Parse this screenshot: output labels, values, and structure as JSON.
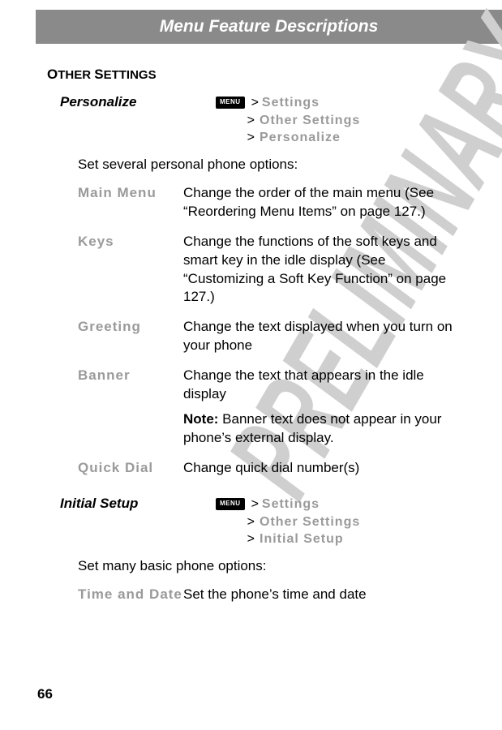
{
  "header": {
    "title": "Menu Feature Descriptions"
  },
  "watermark": "PRELIMINARY",
  "sectionHeading": "OTHER SETTINGS",
  "menuChipLabel": "MENU",
  "gt": ">",
  "entries": [
    {
      "title": "Personalize",
      "nav": [
        "Settings",
        "Other Settings",
        "Personalize"
      ],
      "intro": "Set several personal phone options:",
      "options": [
        {
          "label": "Main Menu",
          "desc": "Change the order of the main menu (See “Reordering Menu Items” on page 127.)"
        },
        {
          "label": "Keys",
          "desc": "Change the functions of the soft keys and smart key in the idle display (See “Customizing a Soft Key Function” on page 127.)"
        },
        {
          "label": "Greeting",
          "desc": "Change the text displayed when you turn on your phone"
        },
        {
          "label": "Banner",
          "desc": "Change the text that appears in the idle display",
          "noteLabel": "Note:",
          "note": " Banner text does not appear in your phone’s external display."
        },
        {
          "label": "Quick Dial",
          "desc": "Change quick dial number(s)"
        }
      ]
    },
    {
      "title": "Initial Setup",
      "nav": [
        "Settings",
        "Other Settings",
        "Initial Setup"
      ],
      "intro": "Set many basic phone options:",
      "options": [
        {
          "label": "Time and Date",
          "desc": "Set the phone’s time and date"
        }
      ]
    }
  ],
  "pageNumber": "66"
}
